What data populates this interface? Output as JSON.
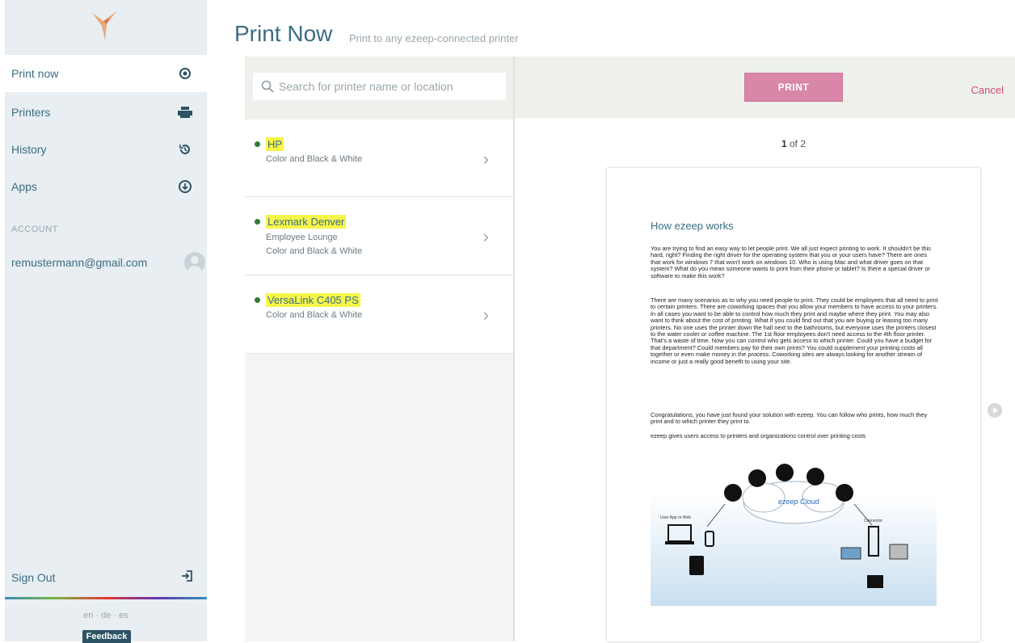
{
  "sidebar": {
    "nav": [
      {
        "label": "Print now",
        "icon": "target-icon",
        "active": true
      },
      {
        "label": "Printers",
        "icon": "printer-icon",
        "active": false
      },
      {
        "label": "History",
        "icon": "history-icon",
        "active": false
      },
      {
        "label": "Apps",
        "icon": "download-icon",
        "active": false
      }
    ],
    "account_label": "ACCOUNT",
    "email": "remustermann@gmail.com",
    "sign_out": "Sign Out",
    "languages": "en · de · es",
    "feedback": "Feedback"
  },
  "header": {
    "title": "Print Now",
    "subtitle": "Print to any ezeep-connected printer"
  },
  "search": {
    "placeholder": "Search for printer name or location"
  },
  "printers": [
    {
      "name": "HP",
      "lines": [
        "Color and Black & White"
      ]
    },
    {
      "name": "Lexmark Denver",
      "lines": [
        "Employee Lounge",
        "Color and Black & White"
      ]
    },
    {
      "name": "VersaLink C405 PS",
      "lines": [
        "Color and Black & White"
      ]
    }
  ],
  "actions": {
    "print": "PRINT",
    "cancel": "Cancel"
  },
  "pager": {
    "current": "1",
    "of_label": "of 2"
  },
  "document": {
    "title": "How ezeep works",
    "paragraphs": [
      "You are trying to find an easy way to let people print. We all just expect printing to work. It shouldn't be this hard, right? Finding the right driver for the operating system that you or your users have? There are ones that work for windows 7 that won't work on windows 10. Who is using Mac and what driver goes on that system? What do you mean someone wants to print from their phone or tablet? Is there a special driver or software to make this work?",
      "There are many scenarios as to why you need people to print. They could be employees that all need to print to certain printers. There are coworking spaces that you allow your members to have access to your printers. In all cases you want to be able to control how much they print and maybe where they print. You may also want to think about the cost of printing. What if you could find out that you are buying or leasing too many printers. No one uses the printer down the hall next to the bathrooms, but everyone uses the printers closest to the water cooler or coffee machine. The 1st floor employees don't need access to the 4th floor printer. That's a waste of time. Now you can control who gets access to which printer. Could you have a budget for that department? Could members pay for their own prints? You could supplement your printing costs all together or even make money in the process. Coworking sites are always looking for another stream of income or just a really good benefit to using your site.",
      "Congratulations, you have just found your solution with ezeep. You can follow who prints, how much they print and to which printer they print to.",
      "ezeep gives users access to printers and organizations control over printing costs"
    ],
    "diagram": {
      "cloud_label": "ezeep Cloud",
      "left_label": "User App or Web",
      "right_label": "Connector"
    }
  }
}
